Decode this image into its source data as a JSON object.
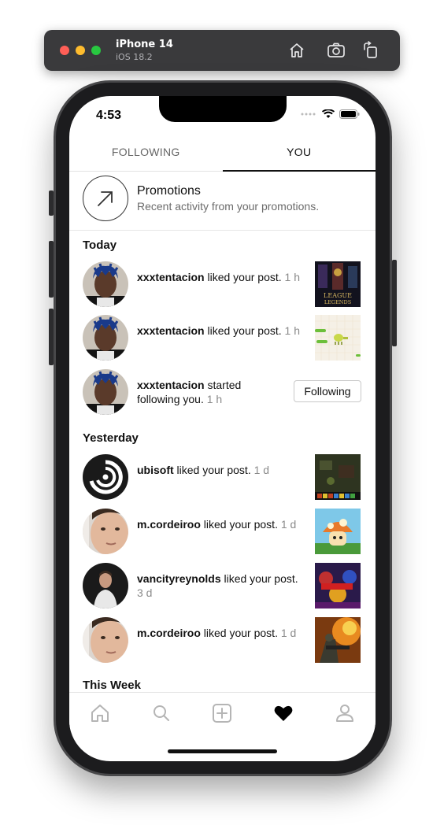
{
  "simulator": {
    "device": "iPhone 14",
    "os": "iOS 18.2",
    "buttons": [
      "home-icon",
      "screenshot-icon",
      "rotate-icon"
    ]
  },
  "status": {
    "time": "4:53"
  },
  "tabs": [
    {
      "label": "FOLLOWING",
      "active": false
    },
    {
      "label": "YOU",
      "active": true
    }
  ],
  "promotions": {
    "title": "Promotions",
    "subtitle": "Recent activity from your promotions."
  },
  "sections": {
    "today": "Today",
    "yesterday": "Yesterday",
    "this_week": "This Week"
  },
  "activities": [
    {
      "user": "xxxtentacion",
      "action": " liked your post. ",
      "time": "1 h",
      "type": "post"
    },
    {
      "user": "xxxtentacion",
      "action": " liked your post. ",
      "time": "1 h",
      "type": "post"
    },
    {
      "user": "xxxtentacion",
      "action": " started following you. ",
      "time": "1 h",
      "type": "follow",
      "button": "Following"
    },
    {
      "user": "ubisoft",
      "action": " liked your post. ",
      "time": "1 d",
      "type": "post"
    },
    {
      "user": "m.cordeiroo",
      "action": " liked your post. ",
      "time": "1 d",
      "type": "post"
    },
    {
      "user": "vancityreynolds",
      "action": " liked your post. ",
      "time": "3 d",
      "type": "post"
    },
    {
      "user": "m.cordeiroo",
      "action": " liked your post. ",
      "time": "1 d",
      "type": "post"
    }
  ],
  "nav": [
    "home-icon",
    "search-icon",
    "add-post-icon",
    "heart-icon",
    "profile-icon"
  ],
  "colors": {
    "text": "#111111",
    "secondary": "#8a8a8a",
    "divider": "#e3e3e3"
  }
}
